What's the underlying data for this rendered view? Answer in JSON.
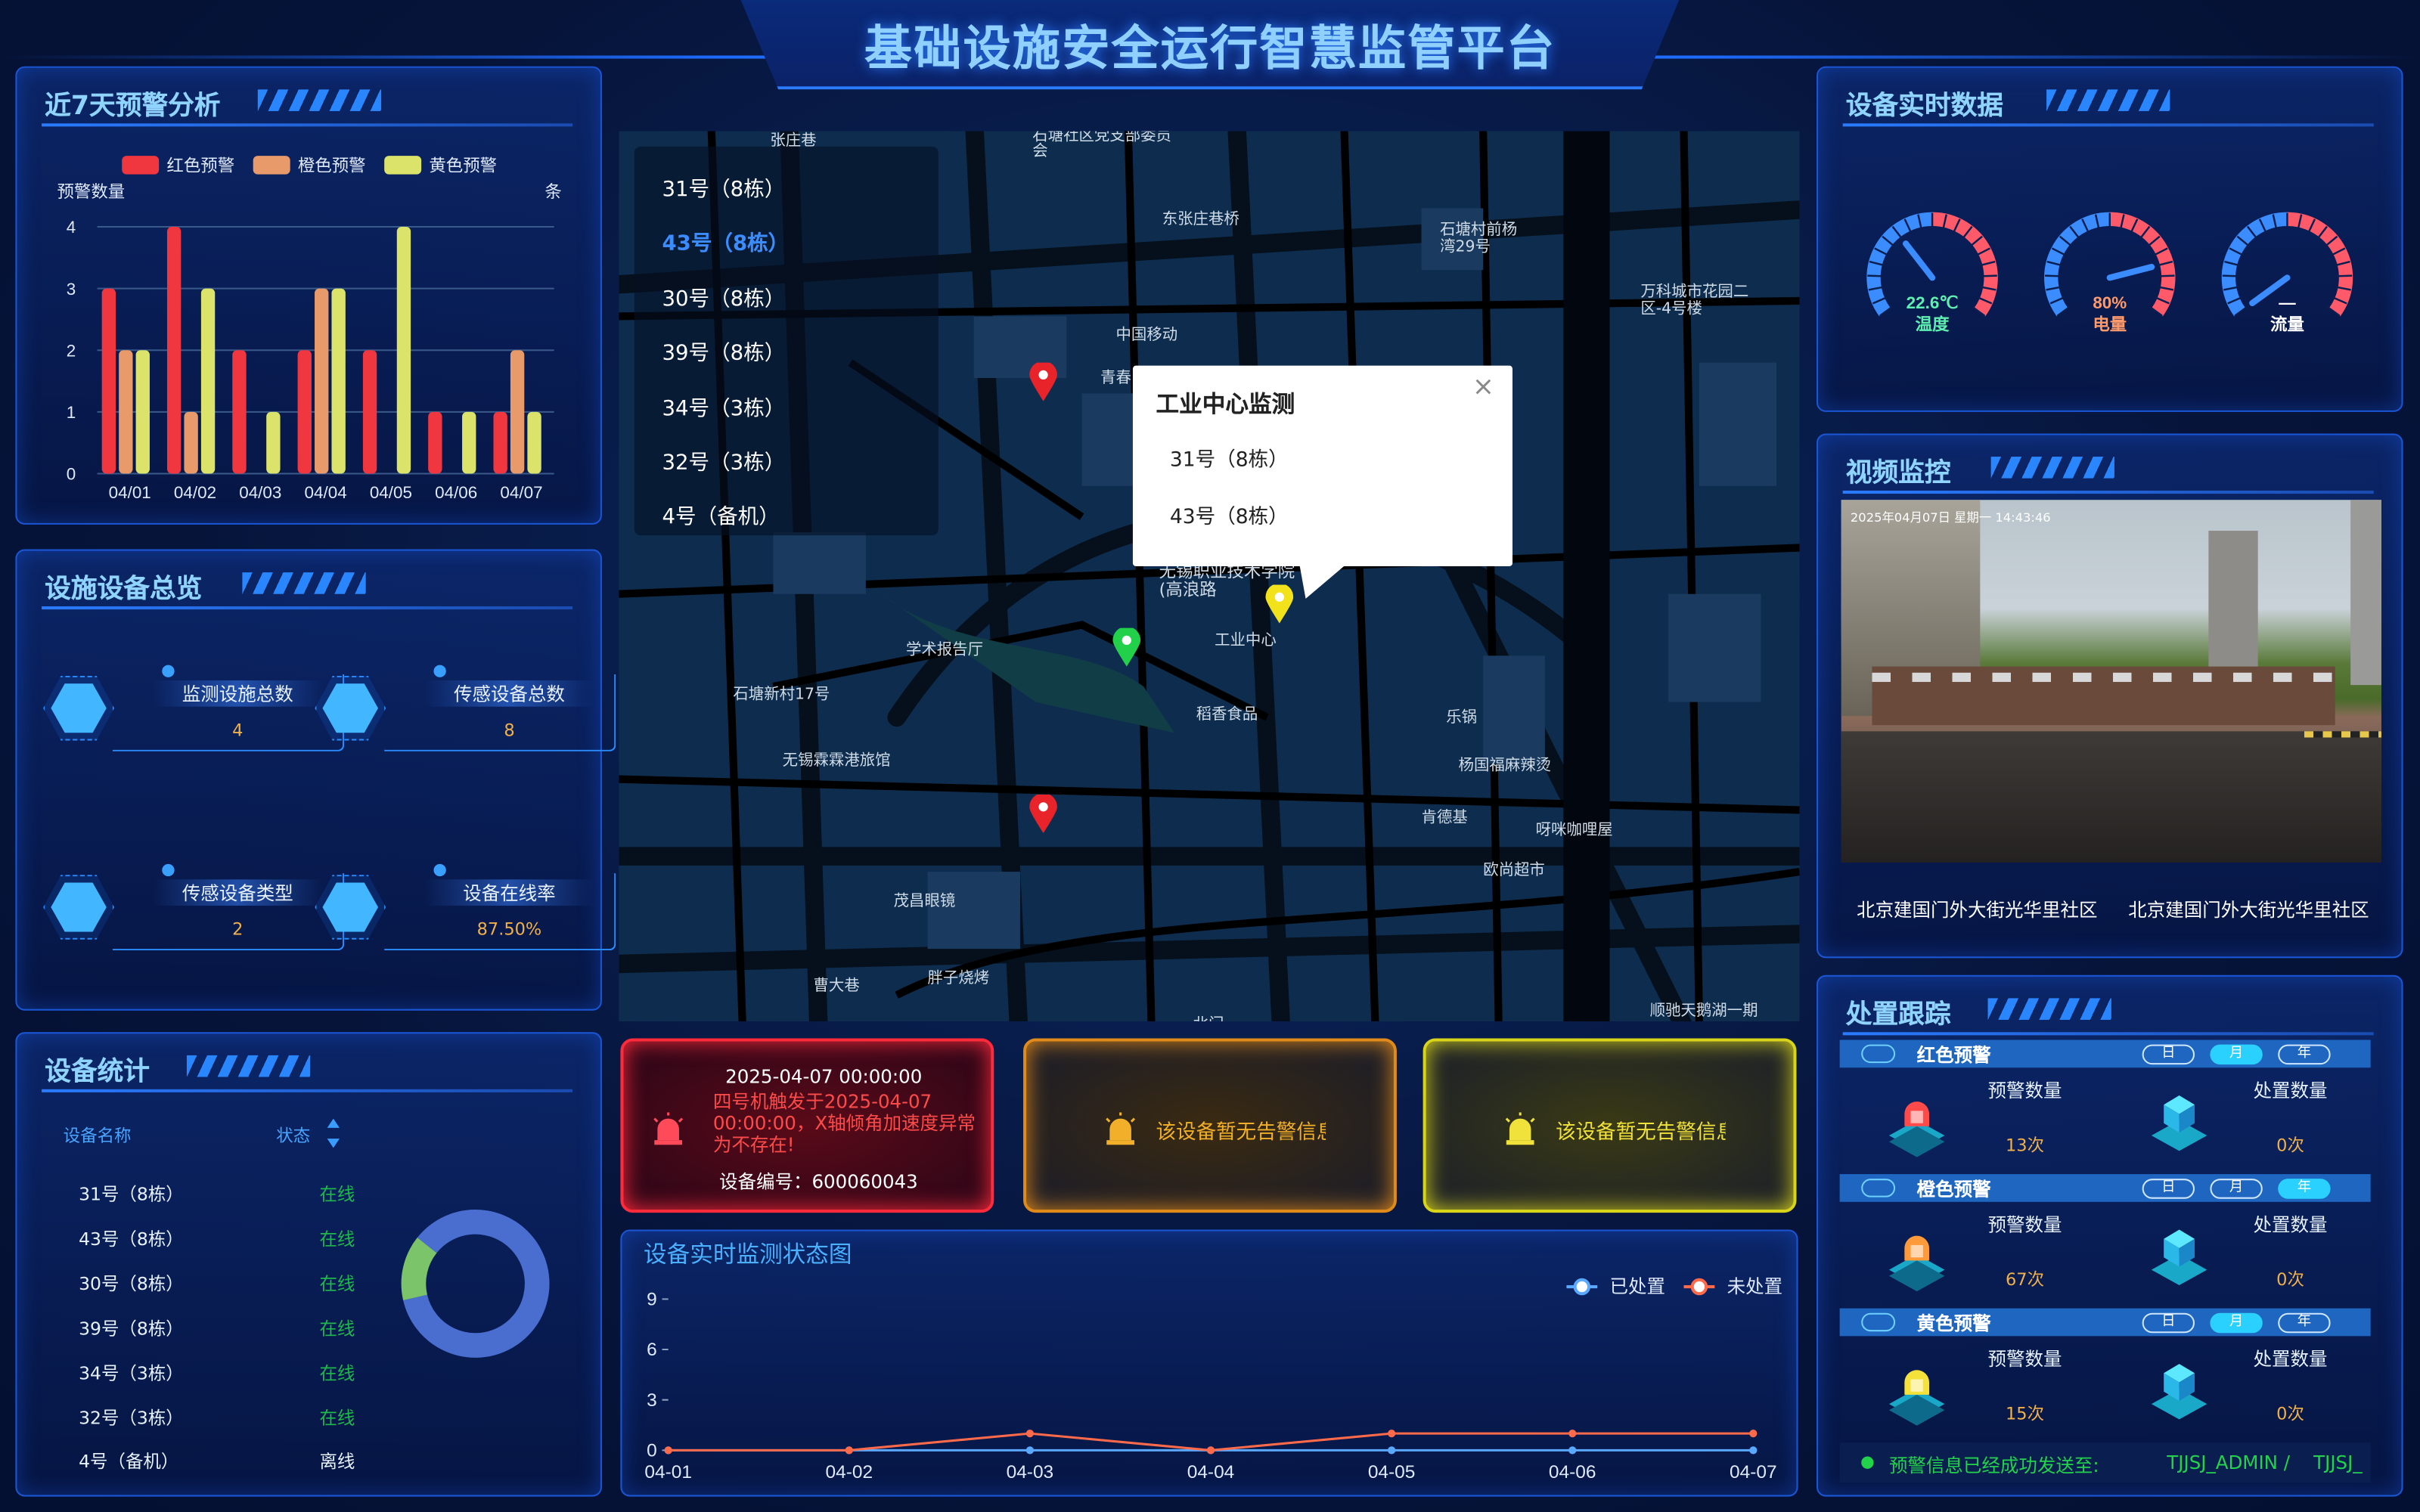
{
  "header": {
    "title": "基础设施安全运行智慧监管平台"
  },
  "warning_panel": {
    "title": "近7天预警分析",
    "legend": [
      "红色预警",
      "橙色预警",
      "黄色预警"
    ],
    "ylabel": "预警数量",
    "unit": "条"
  },
  "chart_data": [
    {
      "type": "bar",
      "categories": [
        "04/01",
        "04/02",
        "04/03",
        "04/04",
        "04/05",
        "04/06",
        "04/07"
      ],
      "series": [
        {
          "name": "红色预警",
          "color": "#f0363f",
          "values": [
            3,
            4,
            2,
            2,
            2,
            1,
            1
          ]
        },
        {
          "name": "橙色预警",
          "color": "#e89a6a",
          "values": [
            2,
            1,
            0,
            3,
            0,
            0,
            2
          ]
        },
        {
          "name": "黄色预警",
          "color": "#dbe36a",
          "values": [
            2,
            3,
            1,
            3,
            4,
            1,
            1
          ]
        }
      ],
      "ylim": [
        0,
        4
      ],
      "yticks": [
        0,
        1,
        2,
        3,
        4
      ],
      "ylabel": "预警数量",
      "grid": true,
      "legend_position": "top"
    },
    {
      "type": "line",
      "title": "设备实时监测状态图",
      "categories": [
        "04-01",
        "04-02",
        "04-03",
        "04-04",
        "04-05",
        "04-06",
        "04-07"
      ],
      "series": [
        {
          "name": "已处置",
          "color": "#5aa8ff",
          "values": [
            0,
            0,
            0,
            0,
            0,
            0,
            0
          ]
        },
        {
          "name": "未处置",
          "color": "#ff6a4a",
          "values": [
            0,
            0,
            1,
            0,
            1,
            1,
            1
          ]
        }
      ],
      "ylim": [
        0,
        9
      ],
      "yticks": [
        0,
        3,
        6,
        9
      ],
      "legend_position": "top-right"
    },
    {
      "type": "pie",
      "title": "",
      "series": [
        {
          "name": "",
          "values": [
            6,
            1
          ]
        }
      ],
      "colors": [
        "#4a6ed0",
        "#7cc46a"
      ]
    }
  ],
  "facilities": {
    "title": "设施设备总览",
    "cards": [
      {
        "label": "监测设施总数",
        "value": "4"
      },
      {
        "label": "传感设备总数",
        "value": "8"
      },
      {
        "label": "传感设备类型",
        "value": "2"
      },
      {
        "label": "设备在线率",
        "value": "87.50%"
      }
    ]
  },
  "device_stats": {
    "title": "设备统计",
    "col_name": "设备名称",
    "col_status": "状态",
    "rows": [
      {
        "name": "31号（8栋）",
        "status": "在线"
      },
      {
        "name": "43号（8栋）",
        "status": "在线"
      },
      {
        "name": "30号（8栋）",
        "status": "在线"
      },
      {
        "name": "39号（8栋）",
        "status": "在线"
      },
      {
        "name": "34号（3栋）",
        "status": "在线"
      },
      {
        "name": "32号（3栋）",
        "status": "在线"
      },
      {
        "name": "4号（备机）",
        "status": "离线"
      }
    ]
  },
  "map": {
    "device_list": [
      "31号（8栋）",
      "43号（8栋）",
      "30号（8栋）",
      "39号（8栋）",
      "34号（3栋）",
      "32号（3栋）",
      "4号（备机）"
    ],
    "selected_index": 1,
    "popup": {
      "title": "工业中心监测",
      "items": [
        "31号（8栋）",
        "43号（8栋）"
      ],
      "close": "×"
    },
    "labels": [
      "张庄巷",
      "石塘社区党支部委员会",
      "东张庄巷桥",
      "石塘村前杨湾29号",
      "万科城市花园二区-4号楼",
      "中国移动",
      "青春",
      "无锡职业技术学院(高浪路",
      "工业中心",
      "学术报告厅",
      "石塘新村17号",
      "稻香食品",
      "乐锅",
      "无锡霖霖港旅馆",
      "杨国福麻辣烫",
      "肯德基",
      "呀咪咖哩屋",
      "欧尚超市",
      "茂昌眼镜",
      "胖子烧烤",
      "曹大巷",
      "北门",
      "顺驰天鹅湖一期"
    ]
  },
  "alerts": [
    {
      "time": "2025-04-07 00:00:00",
      "message": "四号机触发于2025-04-07 00:00:00，X轴倾角加速度异常为不存在!",
      "device": "设备编号：600060043"
    },
    {
      "message": "该设备暂无告警信息"
    },
    {
      "message": "该设备暂无告警信息"
    }
  ],
  "realtime": {
    "title": "设备实时数据",
    "gauges": [
      {
        "value": "22.6℃",
        "label": "温度",
        "color": "#5ef0b0",
        "level": 0.35
      },
      {
        "value": "80%",
        "label": "电量",
        "color": "#ff9a6a",
        "level": 0.8
      },
      {
        "value": "—",
        "label": "流量",
        "color": "#ffffff",
        "level": 0.0
      }
    ]
  },
  "video": {
    "title": "视频监控",
    "overlay": "2025年04月07日 星期一 14:43:46",
    "captions": [
      "北京建国门外大街光华里社区",
      "北京建国门外大街光华里社区"
    ]
  },
  "tracking": {
    "title": "处置跟踪",
    "periods": [
      "日",
      "月",
      "年"
    ],
    "sections": [
      {
        "name": "红色预警",
        "warn_label": "预警数量",
        "warn_value": "13次",
        "handle_label": "处置数量",
        "handle_value": "0次",
        "active": 1,
        "color": "#ff4a4a"
      },
      {
        "name": "橙色预警",
        "warn_label": "预警数量",
        "warn_value": "67次",
        "handle_label": "处置数量",
        "handle_value": "0次",
        "active": 2,
        "color": "#ff9a3a"
      },
      {
        "name": "黄色预警",
        "warn_label": "预警数量",
        "warn_value": "15次",
        "handle_label": "处置数量",
        "handle_value": "0次",
        "active": 1,
        "color": "#f4e23a"
      }
    ],
    "footer": "预警信息已经成功发送至:",
    "footer_targets": "TJJSJ_ADMIN /    TJJSJ_"
  }
}
